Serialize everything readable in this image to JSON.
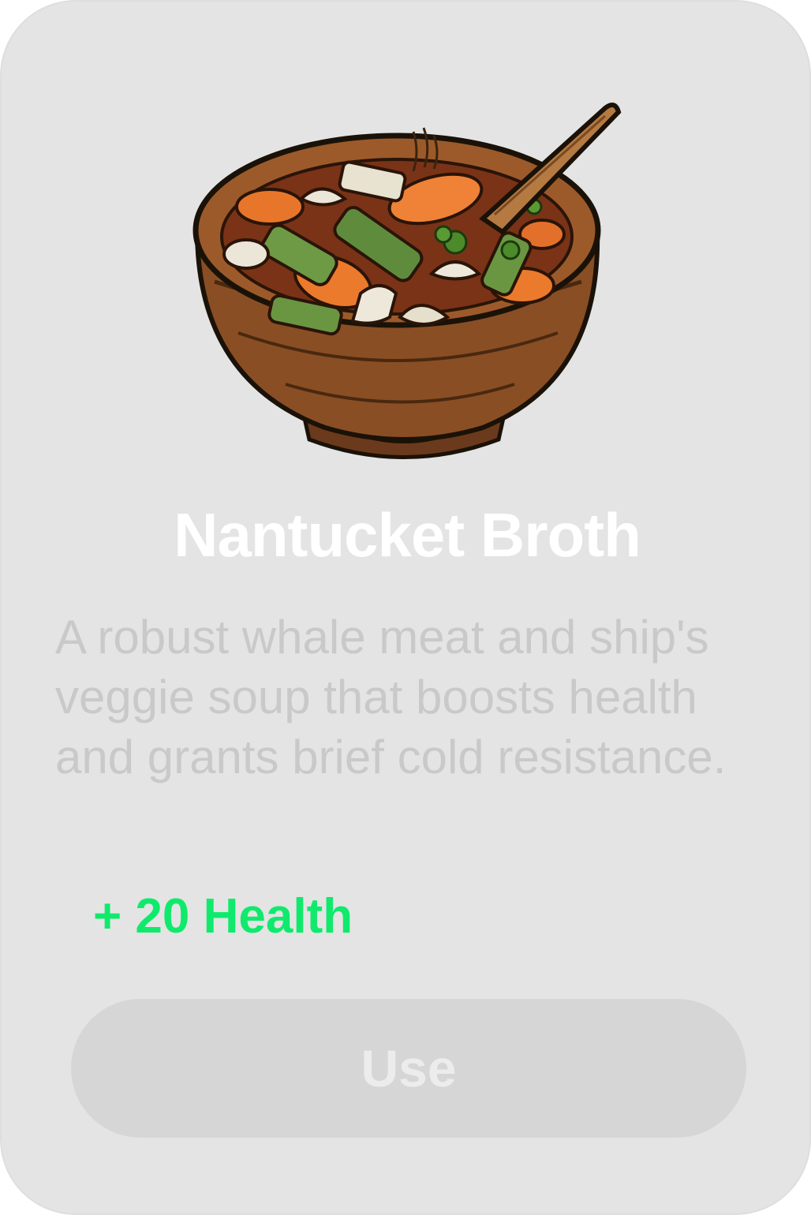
{
  "item": {
    "icon": "soup-bowl-icon",
    "name": "Nantucket Broth",
    "description": "A robust whale meat and ship's veggie soup that boosts health and grants brief cold resistance.",
    "effect": "+ 20 Health"
  },
  "actions": {
    "use_label": "Use"
  },
  "colors": {
    "card_background": "#e4e4e4",
    "title": "#ffffff",
    "description": "#c9c9c9",
    "effect": "#10ea6c",
    "button_background": "#d6d6d6",
    "button_text": "#ececec"
  }
}
